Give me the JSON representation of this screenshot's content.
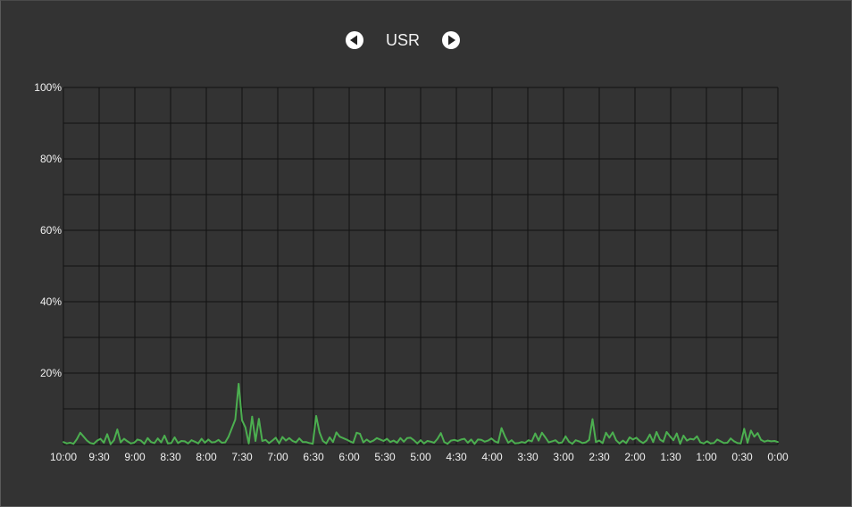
{
  "nav": {
    "title": "USR",
    "prev_icon": "arrow-left-circle-icon",
    "next_icon": "arrow-right-circle-icon"
  },
  "colors": {
    "background": "#333333",
    "grid": "#111111",
    "line": "#4caf50",
    "text": "#f0f0f0"
  },
  "chart_data": {
    "type": "line",
    "title": "USR",
    "xlabel": "",
    "ylabel": "",
    "ylim": [
      0,
      100
    ],
    "y_ticks": [
      0,
      10,
      20,
      30,
      40,
      50,
      60,
      70,
      80,
      90,
      100
    ],
    "y_tick_labels": [
      "",
      "",
      "20%",
      "",
      "40%",
      "",
      "60%",
      "",
      "80%",
      "",
      "100%"
    ],
    "x_tick_labels": [
      "10:00",
      "9:30",
      "9:00",
      "8:30",
      "8:00",
      "7:30",
      "7:00",
      "6:30",
      "6:00",
      "5:30",
      "5:00",
      "4:30",
      "4:00",
      "3:30",
      "3:00",
      "2:30",
      "2:00",
      "1:30",
      "1:00",
      "0:30",
      "0:00"
    ],
    "grid": true,
    "legend": "none",
    "series": [
      {
        "values": [
          0.7,
          0.3,
          0.5,
          0.2,
          1.5,
          3.3,
          2.2,
          1.1,
          0.4,
          0.2,
          1.1,
          1.6,
          0.5,
          2.9,
          0.1,
          1.2,
          4.2,
          0.6,
          1.6,
          0.9,
          0.3,
          0.5,
          1.4,
          1.1,
          0.2,
          1.8,
          0.7,
          0.4,
          1.7,
          0.6,
          2.5,
          0.3,
          0.4,
          2.0,
          0.4,
          1.0,
          0.9,
          0.3,
          1.2,
          0.8,
          0.3,
          1.6,
          0.5,
          1.4,
          0.6,
          0.7,
          1.3,
          0.5,
          0.6,
          2.2,
          4.6,
          7.0,
          17.0,
          6.8,
          4.8,
          0.3,
          7.8,
          1.0,
          7.2,
          1.0,
          1.3,
          0.4,
          1.1,
          1.9,
          0.3,
          2.1,
          1.1,
          1.8,
          1.0,
          0.6,
          1.7,
          0.7,
          0.7,
          0.4,
          0.2,
          8.0,
          3.4,
          1.0,
          0.3,
          2.0,
          0.7,
          3.4,
          2.2,
          1.8,
          1.4,
          0.9,
          0.5,
          3.3,
          3.0,
          0.6,
          1.4,
          0.7,
          1.1,
          1.8,
          1.4,
          1.0,
          1.6,
          0.7,
          1.1,
          0.5,
          1.8,
          0.8,
          1.8,
          1.9,
          1.2,
          0.3,
          1.2,
          0.3,
          1.0,
          0.8,
          0.5,
          1.6,
          3.2,
          0.7,
          0.2,
          1.1,
          1.3,
          1.0,
          1.4,
          1.6,
          0.5,
          1.4,
          0.2,
          1.4,
          1.3,
          0.8,
          1.1,
          1.7,
          0.9,
          0.5,
          4.6,
          2.3,
          0.5,
          1.2,
          0.3,
          0.4,
          0.7,
          0.5,
          1.2,
          0.9,
          3.1,
          1.1,
          3.3,
          2.0,
          0.6,
          0.9,
          1.2,
          0.4,
          0.6,
          2.3,
          0.8,
          0.2,
          1.2,
          0.9,
          0.4,
          0.6,
          1.3,
          7.1,
          0.7,
          1.1,
          0.4,
          3.3,
          1.9,
          3.4,
          1.2,
          0.3,
          1.1,
          0.4,
          2.0,
          1.4,
          1.9,
          1.0,
          0.4,
          1.1,
          2.8,
          0.7,
          3.5,
          1.4,
          0.8,
          3.5,
          2.3,
          1.2,
          3.1,
          0.2,
          2.5,
          1.1,
          1.6,
          1.4,
          2.3,
          0.6,
          0.3,
          0.9,
          0.3,
          0.4,
          1.4,
          0.9,
          0.4,
          0.5,
          1.7,
          0.9,
          0.4,
          0.3,
          4.4,
          0.5,
          3.9,
          2.2,
          3.2,
          1.3,
          0.8,
          1.1,
          0.9,
          1.0,
          0.7
        ]
      }
    ]
  }
}
